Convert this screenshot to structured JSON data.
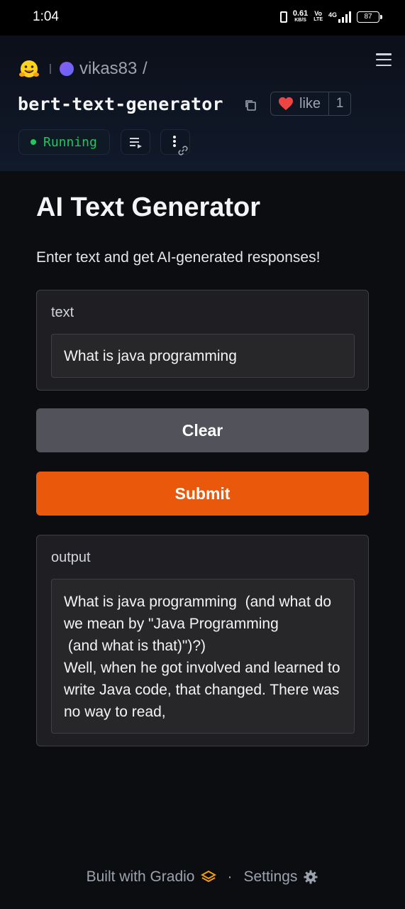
{
  "status_bar": {
    "time": "1:04",
    "net_speed_value": "0.61",
    "net_speed_unit": "KB/S",
    "volte_top": "Vo",
    "volte_bottom": "LTE",
    "network_type": "4G",
    "battery": "87"
  },
  "header": {
    "owner": "vikas83",
    "slash": "/",
    "repo": "bert-text-generator",
    "like_label": "like",
    "like_count": "1",
    "status": "Running"
  },
  "app": {
    "title": "AI Text Generator",
    "description": "Enter text and get AI-generated responses!",
    "input_label": "text",
    "input_value": "What is java programming",
    "clear_label": "Clear",
    "submit_label": "Submit",
    "output_label": "output",
    "output_value": "What is java programming  (and what do we mean by \"Java Programming\n (and what is that)\")?)\nWell, when he got involved and learned to write Java code, that changed. There was no way to read,"
  },
  "footer": {
    "built_with": "Built with Gradio",
    "separator": "·",
    "settings": "Settings"
  },
  "colors": {
    "accent_orange": "#ea580c",
    "clear_gray": "#52525b",
    "running_green": "#22c55e",
    "like_red": "#ef4444"
  },
  "icons": [
    "hugging-face-logo",
    "copy-icon",
    "heart-icon",
    "menu-icon",
    "playlist-icon",
    "more-vert-icon",
    "link-icon",
    "gradio-logo-icon",
    "gear-icon"
  ]
}
